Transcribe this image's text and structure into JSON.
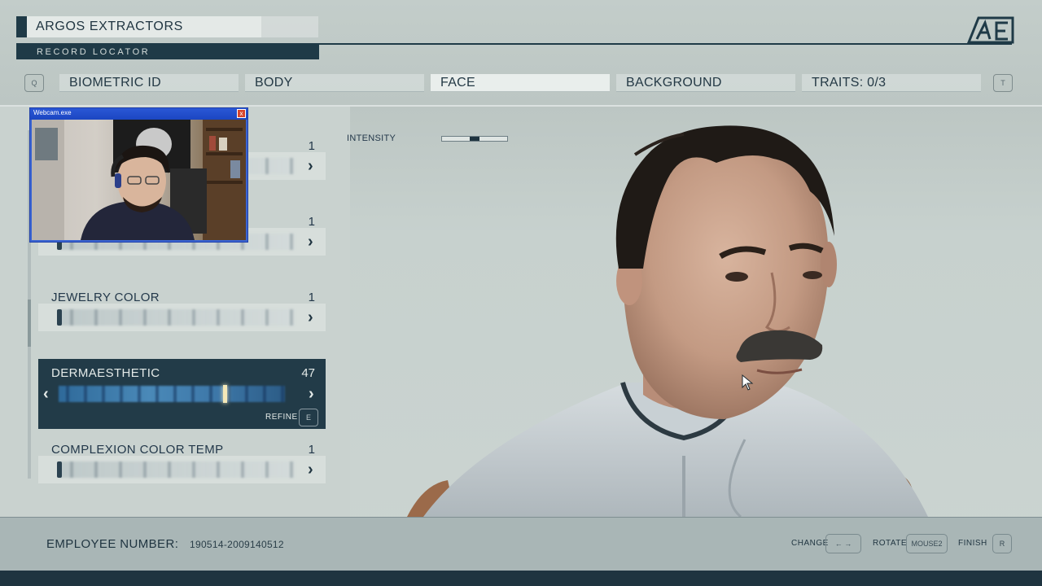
{
  "header": {
    "title": "ARGOS EXTRACTORS",
    "subtitle": "RECORD LOCATOR",
    "logo_text": "AE"
  },
  "tabs": {
    "prev_key": "Q",
    "next_key": "T",
    "items": [
      {
        "label": "BIOMETRIC ID"
      },
      {
        "label": "BODY"
      },
      {
        "label": "FACE",
        "active": true
      },
      {
        "label": "BACKGROUND"
      },
      {
        "label": "TRAITS: 0/3"
      }
    ]
  },
  "options": [
    {
      "label": "",
      "value": "1"
    },
    {
      "label": "",
      "value": "1"
    },
    {
      "label": "JEWELRY COLOR",
      "value": "1"
    },
    {
      "label": "DERMAESTHETIC",
      "value": "47",
      "selected": true
    },
    {
      "label": "COMPLEXION COLOR TEMP",
      "value": "1"
    }
  ],
  "refine": {
    "label": "REFINE",
    "key": "E"
  },
  "intensity": {
    "label": "INTENSITY",
    "level": 0.5
  },
  "webcam": {
    "title": "Webcam.exe",
    "close": "x"
  },
  "footer": {
    "employee_label": "EMPLOYEE NUMBER:",
    "employee_number": "190514-2009140512",
    "change_label": "CHANGE",
    "change_key": "← →",
    "rotate_label": "ROTATE",
    "rotate_key": "MOUSE2",
    "finish_label": "FINISH",
    "finish_key": "R"
  },
  "colors": {
    "accent_dark": "#1f3a47",
    "selected_bg": "#223b48",
    "slider_blue": "#4a89b8"
  }
}
